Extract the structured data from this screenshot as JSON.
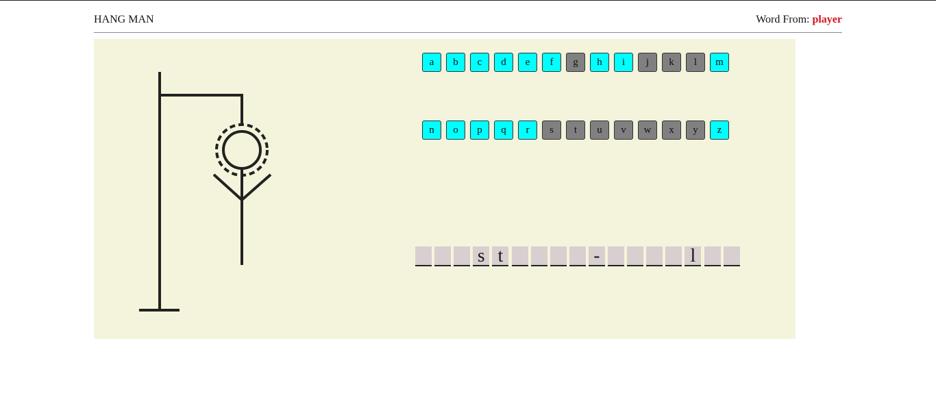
{
  "header": {
    "title": "HANG MAN",
    "word_from_label": "Word From:",
    "word_from_value": "player"
  },
  "colors": {
    "board_bg": "#f4f4dc",
    "available_key": "#00ffff",
    "used_key": "#808080",
    "accent_red": "#d0161e",
    "slot_bg": "#d8cfd0"
  },
  "keyboard": {
    "row1": [
      {
        "letter": "a",
        "used": false
      },
      {
        "letter": "b",
        "used": false
      },
      {
        "letter": "c",
        "used": false
      },
      {
        "letter": "d",
        "used": false
      },
      {
        "letter": "e",
        "used": false
      },
      {
        "letter": "f",
        "used": false
      },
      {
        "letter": "g",
        "used": true
      },
      {
        "letter": "h",
        "used": false
      },
      {
        "letter": "i",
        "used": false
      },
      {
        "letter": "j",
        "used": true
      },
      {
        "letter": "k",
        "used": true
      },
      {
        "letter": "l",
        "used": true
      },
      {
        "letter": "m",
        "used": false
      }
    ],
    "row2": [
      {
        "letter": "n",
        "used": false
      },
      {
        "letter": "o",
        "used": false
      },
      {
        "letter": "p",
        "used": false
      },
      {
        "letter": "q",
        "used": false
      },
      {
        "letter": "r",
        "used": false
      },
      {
        "letter": "s",
        "used": true
      },
      {
        "letter": "t",
        "used": true
      },
      {
        "letter": "u",
        "used": true
      },
      {
        "letter": "v",
        "used": true
      },
      {
        "letter": "w",
        "used": true
      },
      {
        "letter": "x",
        "used": true
      },
      {
        "letter": "y",
        "used": true
      },
      {
        "letter": "z",
        "used": false
      }
    ]
  },
  "word_slots": [
    "",
    "",
    "",
    "s",
    "t",
    "",
    "",
    "",
    "",
    "-",
    "",
    "",
    "",
    "",
    "l",
    "",
    ""
  ],
  "hangman": {
    "parts_shown": [
      "head",
      "halo",
      "body",
      "left-arm",
      "right-arm"
    ]
  }
}
